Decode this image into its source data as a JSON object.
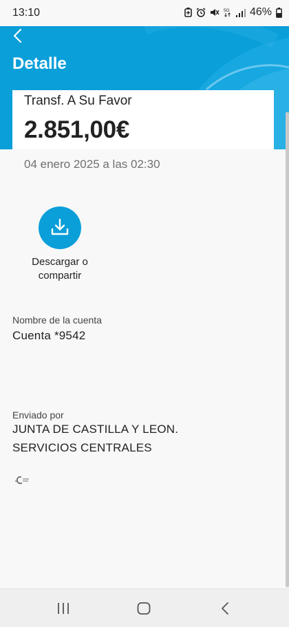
{
  "status_bar": {
    "time": "13:10",
    "battery_percent": "46%",
    "icons": [
      "battery-saver-icon",
      "alarm-icon",
      "mute-icon",
      "5g-icon",
      "signal-icon",
      "battery-icon"
    ]
  },
  "header": {
    "title": "Detalle",
    "back_icon": "chevron-left-icon",
    "accent_color": "#0a9fd9"
  },
  "transaction": {
    "label": "Transf. A Su Favor",
    "amount": "2.851,00€",
    "datetime": "04 enero 2025 a las 02:30"
  },
  "actions": {
    "download_icon": "download-icon",
    "download_label": "Descargar o compartir"
  },
  "details": {
    "account_label": "Nombre de la cuenta",
    "account_value": "Cuenta *9542",
    "sender_label": "Enviado por",
    "sender_line1": "JUNTA DE CASTILLA Y LEON.",
    "sender_line2": "SERVICIOS CENTRALES"
  },
  "navigation": {
    "buttons": [
      "recent-apps-icon",
      "home-icon",
      "back-icon"
    ]
  }
}
